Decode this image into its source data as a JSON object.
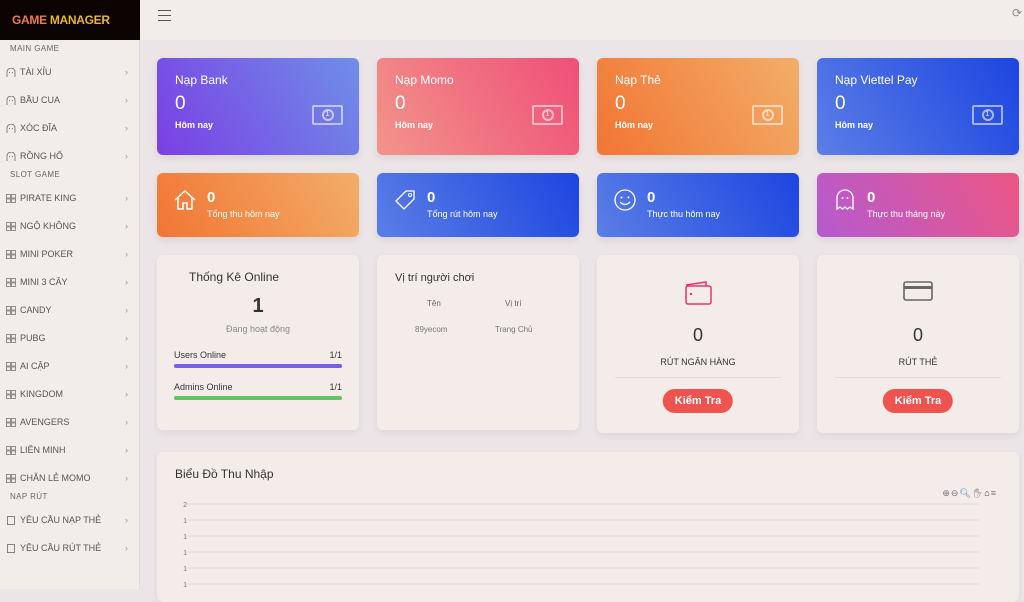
{
  "app": {
    "logo_part1": "GAME",
    "logo_part2": "MANAGER"
  },
  "sidebar": {
    "sections": [
      {
        "title": "MAIN GAME",
        "items": [
          "TÀI XỈU",
          "BẦU CUA",
          "XÓC ĐĨA",
          "RỒNG HỔ"
        ],
        "icon": "ghost-icon"
      },
      {
        "title": "SLOT GAME",
        "items": [
          "PIRATE KING",
          "NGỘ KHÔNG",
          "MINI POKER",
          "MINI 3 CÂY",
          "CANDY",
          "PUBG",
          "AI CẬP",
          "KINGDOM",
          "AVENGERS",
          "LIÊN MINH",
          "CHẴN LẺ MOMO"
        ],
        "icon": "grid-icon"
      },
      {
        "title": "NẠP RÚT",
        "items": [
          "YÊU CẦU NẠP THẺ",
          "YÊU CẦU RÚT THẺ"
        ],
        "icon": "card-icon"
      }
    ]
  },
  "deposit_cards": [
    {
      "title": "Nạp Bank",
      "value": "0",
      "sub": "Hôm nay",
      "gradient": [
        "#7b3fe4",
        "#6f8ee8"
      ]
    },
    {
      "title": "Nạp Momo",
      "value": "0",
      "sub": "Hôm nay",
      "gradient": [
        "#f2948a",
        "#ef4f78"
      ]
    },
    {
      "title": "Nạp Thẻ",
      "value": "0",
      "sub": "Hôm nay",
      "gradient": [
        "#f27534",
        "#f2ae68"
      ]
    },
    {
      "title": "Nạp Viettel Pay",
      "value": "0",
      "sub": "Hôm nay",
      "gradient": [
        "#5b7ee6",
        "#1c45e0"
      ]
    }
  ],
  "summary_cards": [
    {
      "value": "0",
      "label": "Tổng thu hôm nay",
      "icon": "home-icon",
      "gradient": [
        "#f27534",
        "#f2ae68"
      ]
    },
    {
      "value": "0",
      "label": "Tổng rút hôm nay",
      "icon": "tag-icon",
      "gradient": [
        "#5b7ee6",
        "#1c45e0"
      ]
    },
    {
      "value": "0",
      "label": "Thực thu hôm nay",
      "icon": "smile-icon",
      "gradient": [
        "#5b7ee6",
        "#1c45e0"
      ]
    },
    {
      "value": "0",
      "label": "Thực thu tháng này",
      "icon": "ghost-icon",
      "gradient": [
        "#b55ad0",
        "#ec5684"
      ]
    }
  ],
  "online": {
    "title": "Thống Kê Online",
    "count": "1",
    "status": "Đang hoạt động",
    "rows": [
      {
        "label": "Users Online",
        "value": "1/1",
        "percent": 100,
        "color": "#7360e6"
      },
      {
        "label": "Admins Online",
        "value": "1/1",
        "percent": 100,
        "color": "#62c462"
      }
    ]
  },
  "players": {
    "title": "Vị trí người chơi",
    "columns": [
      "Tên",
      "Vị trí"
    ],
    "rows": [
      [
        "89yecom",
        "Trang Chủ"
      ]
    ]
  },
  "withdraw": [
    {
      "value": "0",
      "label": "RÚT NGÂN HÀNG",
      "button": "Kiểm Tra",
      "icon": "wallet-icon"
    },
    {
      "value": "0",
      "label": "RÚT THẺ",
      "button": "Kiểm Tra",
      "icon": "credit-card-icon"
    }
  ],
  "chart": {
    "title": "Biểu Đồ Thu Nhập"
  },
  "chart_data": {
    "type": "line",
    "title": "Biểu Đồ Thu Nhập",
    "y_tick_labels": [
      "2",
      "1",
      "1",
      "1",
      "1",
      "1"
    ],
    "grid": true,
    "series": []
  }
}
